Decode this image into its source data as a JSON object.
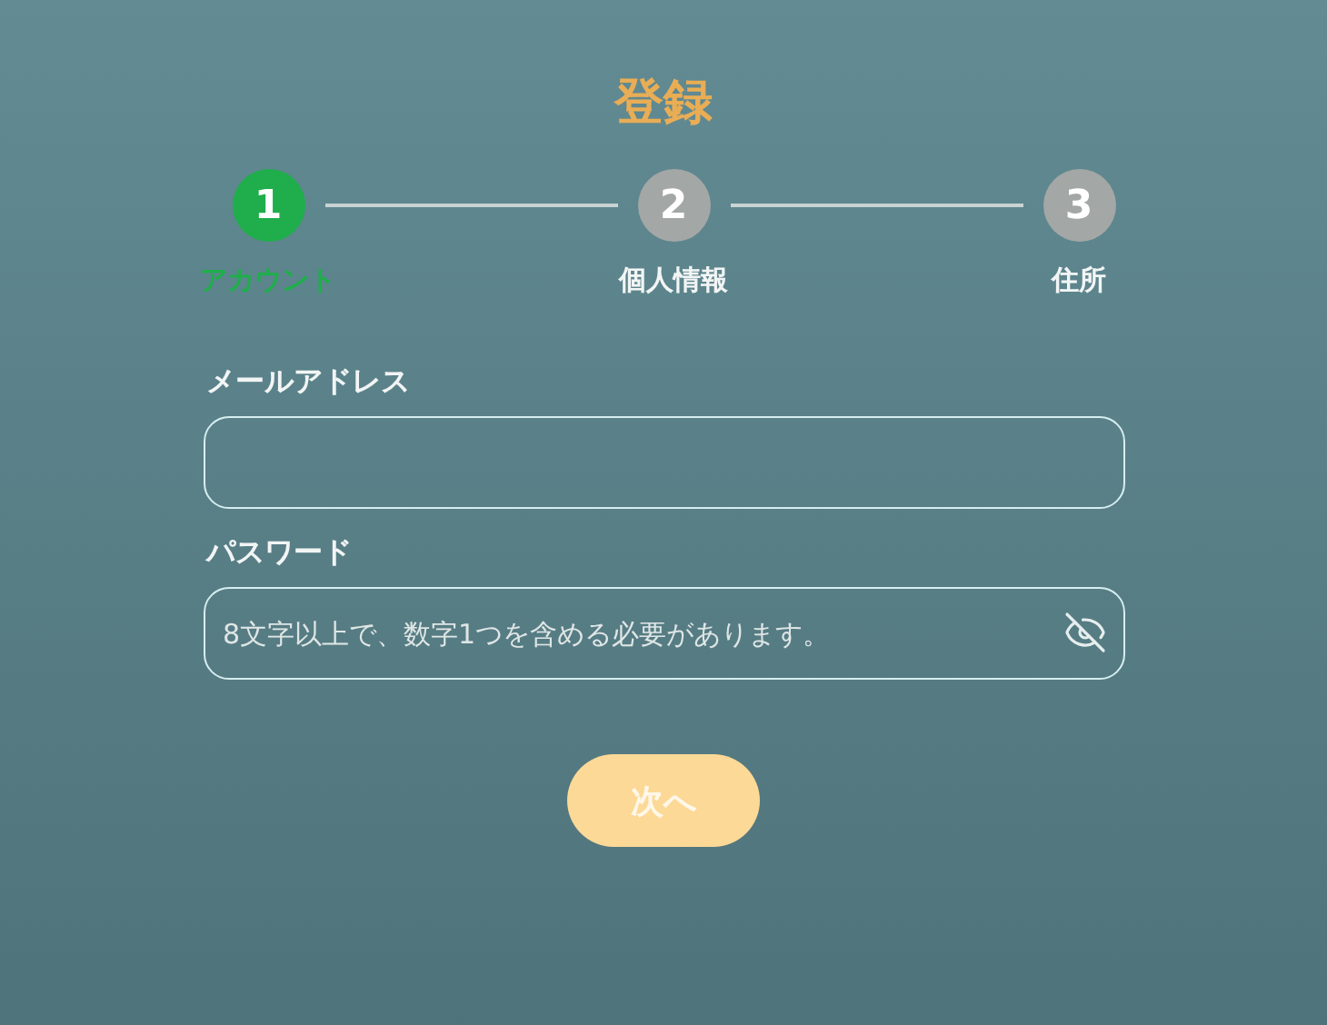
{
  "title": "登録",
  "steps": [
    {
      "number": "1",
      "label": "アカウント",
      "selected": true
    },
    {
      "number": "2",
      "label": "個人情報",
      "selected": false
    },
    {
      "number": "3",
      "label": "住所",
      "selected": false
    }
  ],
  "fields": [
    {
      "label": "メールアドレス",
      "kind": "text"
    },
    {
      "label": "パスワード",
      "kind": "password",
      "placeholder": "8文字以上で、数字1つを含める必要があります。"
    }
  ],
  "next_button": {
    "label": "次へ",
    "disabled": true
  }
}
